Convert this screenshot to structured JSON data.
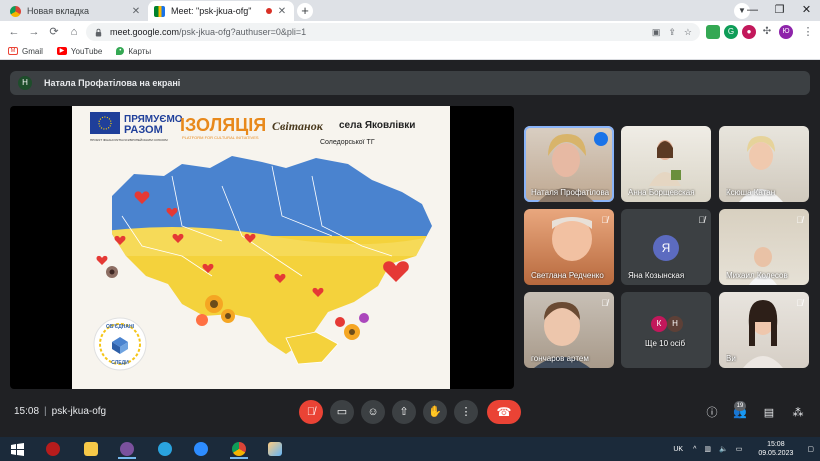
{
  "browser": {
    "tabs": [
      {
        "title": "Новая вкладка",
        "active": false
      },
      {
        "title": "Meet: \"psk-jkua-ofg\"",
        "active": true
      }
    ],
    "url_host": "meet.google.com",
    "url_path": "/psk-jkua-ofg?authuser=0&pli=1",
    "profile_initial": "Ю",
    "bookmarks": [
      "Gmail",
      "YouTube",
      "Карты"
    ]
  },
  "meet": {
    "presenter_initial": "Н",
    "presenting_text": "Натала Профатілова на екрані",
    "meeting_time": "15:08",
    "meeting_code": "psk-jkua-ofg",
    "people_count": "19",
    "slide": {
      "logo_eu": "ПРЯМУЄМО",
      "logo_eu_2": "РАЗОМ",
      "logo_izolyatsia": "ІЗОЛЯЦІЯ",
      "logo_izolyatsia_sub": "PLATFORM FOR CULTURAL INITIATIVES",
      "logo_svitanok": "Світанок",
      "village": "села Яковлівки",
      "community": "Соледорської ТГ",
      "eu_note": "ПРОЄКТ ФІНАНСУЄТЬСЯ ЄВРОПЕЙСЬКИМ СОЮЗОМ",
      "badge_top": "ОБ'ЄДНАНІ",
      "badge_bottom": "СЛЕДИ"
    },
    "participants": [
      {
        "name": "Наталя Профатілова",
        "kind": "video",
        "muted": false,
        "speaking": true
      },
      {
        "name": "Анна Борщевская",
        "kind": "video",
        "muted": false
      },
      {
        "name": "Ксюша Катан",
        "kind": "video",
        "muted": false
      },
      {
        "name": "Светлана Редченко",
        "kind": "video",
        "muted": true
      },
      {
        "name": "Яна Козынская",
        "kind": "avatar",
        "initial": "Я",
        "color": "#5c6bc0",
        "muted": true
      },
      {
        "name": "Михаил Колесов",
        "kind": "video",
        "muted": true
      },
      {
        "name": "гончаров артем",
        "kind": "video",
        "muted": true
      },
      {
        "name": "Ще 10 осіб",
        "kind": "group",
        "initials": [
          "К",
          "Н"
        ],
        "muted": false
      },
      {
        "name": "Ви",
        "kind": "video",
        "muted": true
      }
    ]
  },
  "taskbar": {
    "lang": "UK",
    "time": "15:08",
    "date": "09.05.2023"
  }
}
